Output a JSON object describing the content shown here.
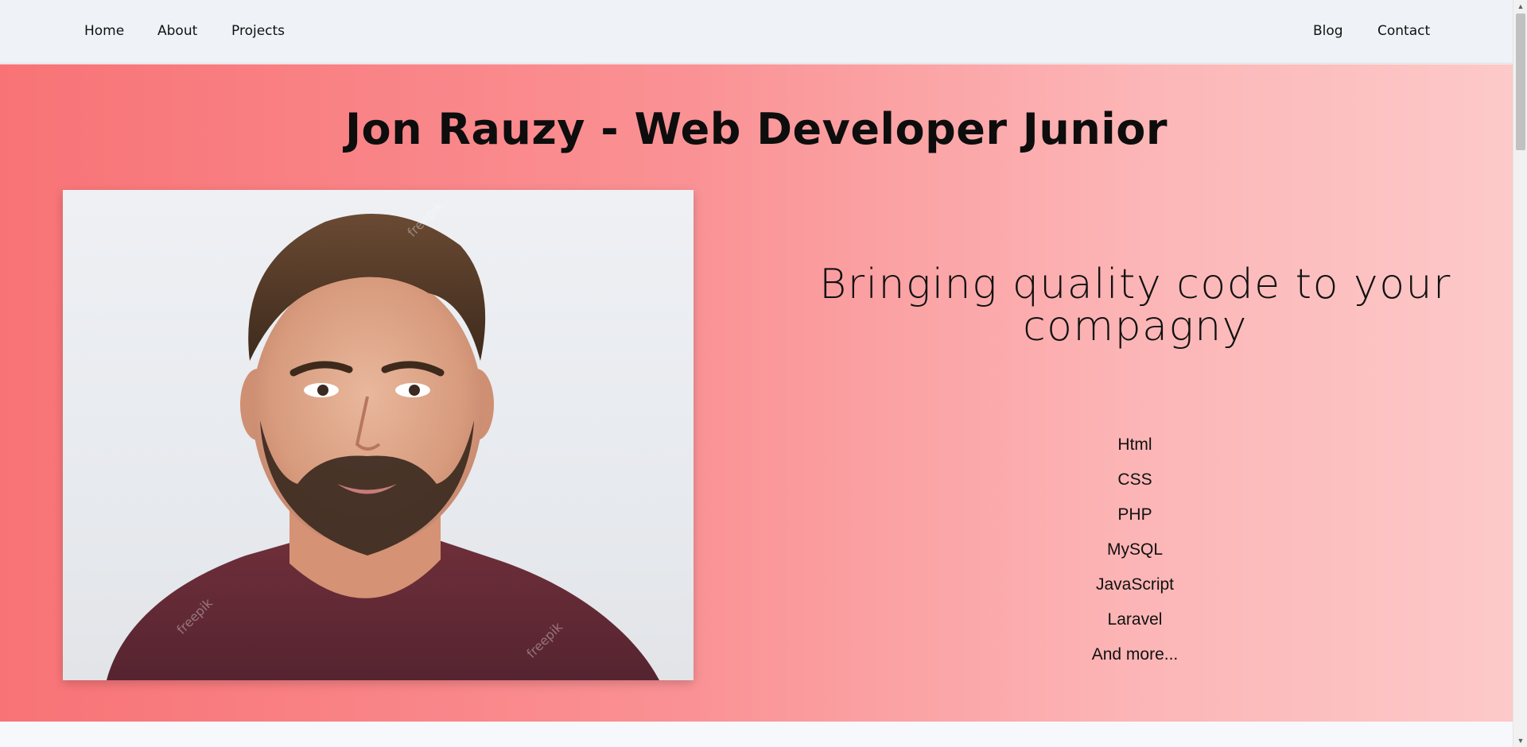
{
  "nav": {
    "left": [
      "Home",
      "About",
      "Projects"
    ],
    "right": [
      "Blog",
      "Contact"
    ]
  },
  "hero": {
    "title": "Jon Rauzy - Web Developer Junior",
    "tagline": "Bringing quality code to your compagny",
    "skills": [
      "Html",
      "CSS",
      "PHP",
      "MySQL",
      "JavaScript",
      "Laravel",
      "And more..."
    ]
  },
  "portrait": {
    "alt": "Portrait of a bearded young man in a maroon t-shirt",
    "watermark": "freepik"
  },
  "scrollbar": {
    "up_glyph": "▲",
    "down_glyph": "▼"
  },
  "colors": {
    "nav_bg": "#eff3f8",
    "hero_gradient_start": "#f87376",
    "hero_gradient_end": "#fdc9c9",
    "text": "#111111"
  }
}
